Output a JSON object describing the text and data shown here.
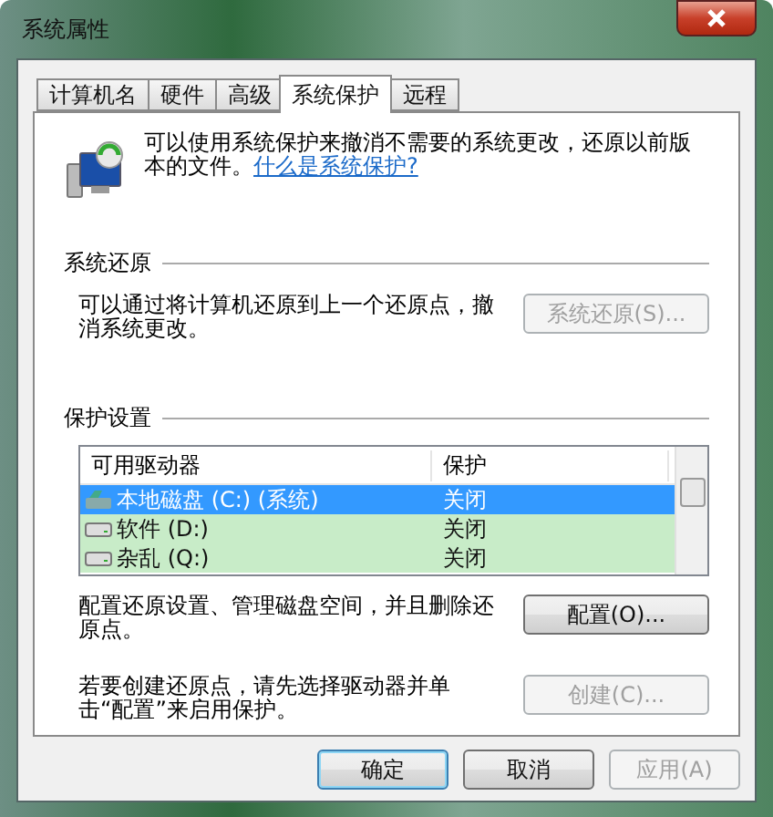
{
  "window": {
    "title": "系统属性"
  },
  "tabs": [
    {
      "label": "计算机名",
      "selected": false
    },
    {
      "label": "硬件",
      "selected": false
    },
    {
      "label": "高级",
      "selected": false
    },
    {
      "label": "系统保护",
      "selected": true
    },
    {
      "label": "远程",
      "selected": false
    }
  ],
  "intro": {
    "text": "可以使用系统保护来撤消不需要的系统更改，还原以前版本的文件。",
    "link": "什么是系统保护?"
  },
  "restore": {
    "heading": "系统还原",
    "text": "可以通过将计算机还原到上一个还原点，撤消系统更改。",
    "button": {
      "label": "系统还原(S)...",
      "disabled": true
    }
  },
  "protection": {
    "heading": "保护设置",
    "columns": [
      "可用驱动器",
      "保护"
    ],
    "drives": [
      {
        "name": "本地磁盘 (C:) (系统)",
        "protection": "关闭",
        "kind": "system",
        "selected": true
      },
      {
        "name": "软件 (D:)",
        "protection": "关闭",
        "kind": "disk",
        "selected": false
      },
      {
        "name": "杂乱 (Q:)",
        "protection": "关闭",
        "kind": "disk",
        "selected": false
      }
    ],
    "configure": {
      "text": "配置还原设置、管理磁盘空间，并且删除还原点。",
      "button": {
        "label": "配置(O)...",
        "disabled": false
      }
    },
    "create": {
      "text": "若要创建还原点，请先选择驱动器并单击“配置”来启用保护。",
      "button": {
        "label": "创建(C)...",
        "disabled": true
      }
    }
  },
  "buttons": [
    {
      "label": "确定",
      "disabled": false,
      "default": true
    },
    {
      "label": "取消",
      "disabled": false,
      "default": false
    },
    {
      "label": "应用(A)",
      "disabled": true,
      "default": false
    }
  ]
}
